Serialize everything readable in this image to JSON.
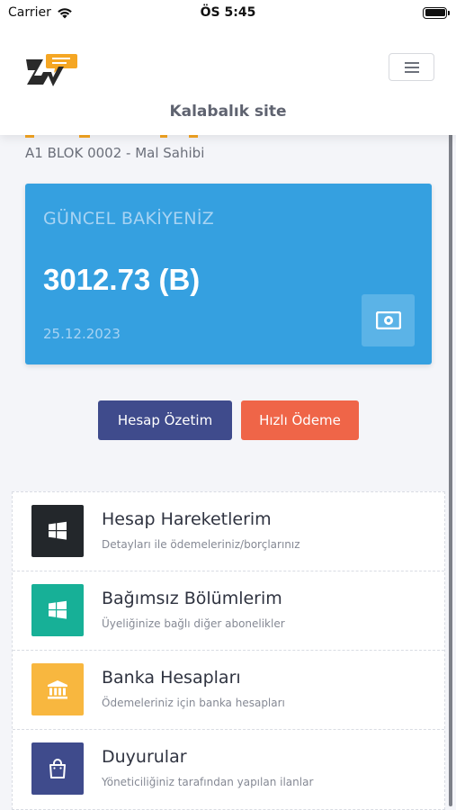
{
  "status": {
    "carrier": "Carrier",
    "time": "ÖS 5:45"
  },
  "header": {
    "site_name": "Kalabalık site",
    "menu_icon": "hamburger-menu-icon"
  },
  "account": {
    "owner_line": "A1 BLOK 0002 - Mal Sahibi"
  },
  "balance": {
    "title": "GÜNCEL BAKİYENİZ",
    "amount": "3012.73 (B)",
    "date": "25.12.2023",
    "icon": "money-bill-icon"
  },
  "actions": {
    "summary_label": "Hesap Özetim",
    "pay_label": "Hızlı Ödeme"
  },
  "menu": [
    {
      "title": "Hesap Hareketlerim",
      "subtitle": "Detayları ile ödemeleriniz/borçlarınız",
      "icon": "windows-icon",
      "color": "#23272b"
    },
    {
      "title": "Bağımsız Bölümlerim",
      "subtitle": "Üyeliğinize bağlı diğer abonelikler",
      "icon": "windows-icon",
      "color": "#17b097"
    },
    {
      "title": "Banka Hesapları",
      "subtitle": "Ödemeleriniz için banka hesapları",
      "icon": "bank-icon",
      "color": "#f8b73f"
    },
    {
      "title": "Duyurular",
      "subtitle": "Yöneticiliğiniz tarafından yapılan ilanlar",
      "icon": "shopping-bag-icon",
      "color": "#3f4b8c"
    }
  ],
  "colors": {
    "brand_orange": "#f5a623",
    "card_blue": "#35a0e0",
    "button_navy": "#3f4b8c",
    "button_orange": "#ef6548"
  }
}
